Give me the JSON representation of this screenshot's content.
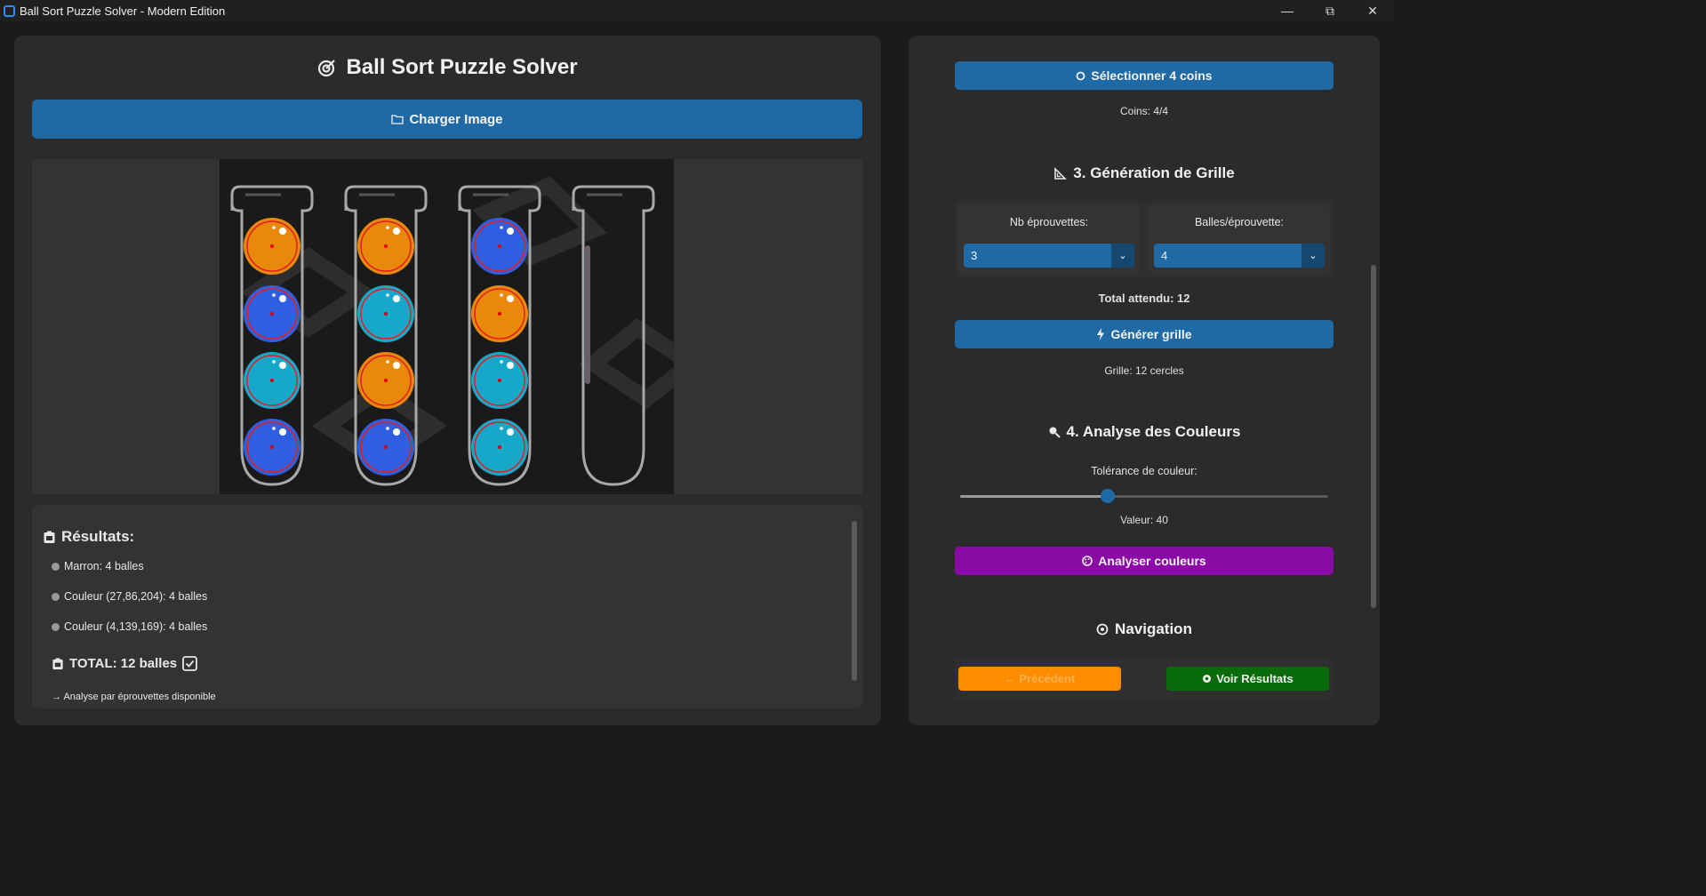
{
  "window": {
    "title": "Ball Sort Puzzle Solver - Modern Edition"
  },
  "app": {
    "title": "Ball Sort Puzzle Solver",
    "load_button": "Charger Image"
  },
  "puzzle": {
    "tubes": [
      {
        "balls": [
          "orange",
          "blue",
          "teal",
          "blue"
        ]
      },
      {
        "balls": [
          "orange",
          "teal",
          "orange",
          "blue"
        ]
      },
      {
        "balls": [
          "blue",
          "orange",
          "teal",
          "teal"
        ]
      },
      {
        "balls": []
      }
    ],
    "colors": {
      "orange": "#e8890c",
      "blue": "#2f5fe0",
      "teal": "#17a7c9"
    }
  },
  "results": {
    "title": "Résultats:",
    "lines": [
      "Marron: 4 balles",
      "Couleur (27,86,204): 4 balles",
      "Couleur (4,139,169): 4 balles"
    ],
    "total": "TOTAL: 12 balles",
    "footer": "→ Analyse par éprouvettes disponible"
  },
  "corners": {
    "button": "Sélectionner 4 coins",
    "status": "Coins: 4/4"
  },
  "grid": {
    "heading": "3. Génération de Grille",
    "tubes_label": "Nb éprouvettes:",
    "tubes_value": "3",
    "balls_label": "Balles/éprouvette:",
    "balls_value": "4",
    "total_expected": "Total attendu: 12",
    "button": "Générer grille",
    "status": "Grille: 12 cercles"
  },
  "colors": {
    "heading": "4. Analyse des Couleurs",
    "tolerance_label": "Tolérance de couleur:",
    "tolerance_value": 40,
    "tolerance_max": 100,
    "value_text": "Valeur: 40",
    "button": "Analyser couleurs"
  },
  "navigation": {
    "heading": "Navigation",
    "prev": "← Précédent",
    "next": "Voir Résultats"
  },
  "theme": {
    "accent": "#1f6aa5",
    "purple": "#8a0aa6",
    "orange": "#ff8c00",
    "green": "#0a6b0a"
  }
}
